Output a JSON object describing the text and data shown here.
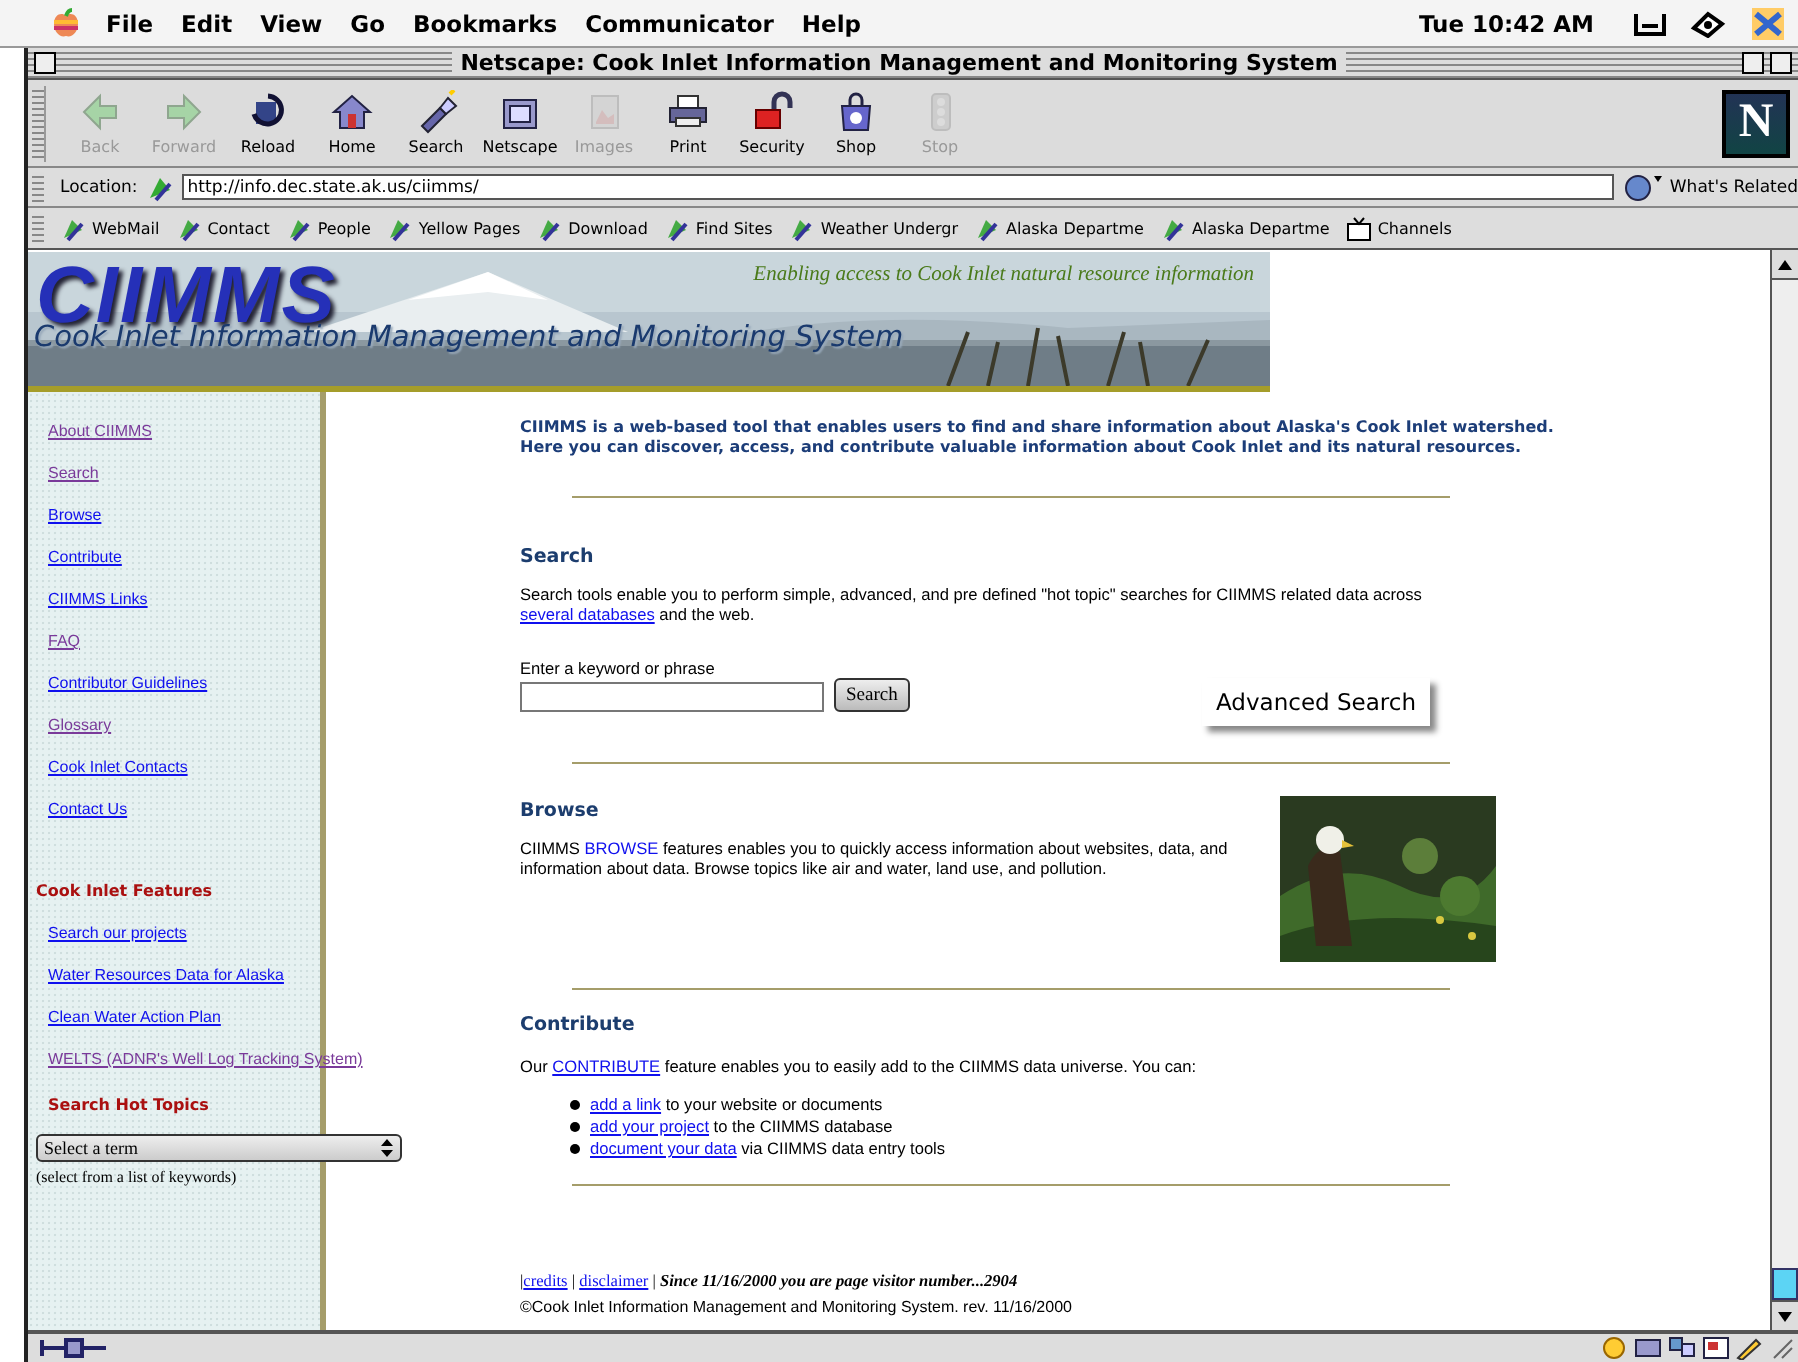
{
  "menu_bar": {
    "menus": [
      "File",
      "Edit",
      "View",
      "Go",
      "Bookmarks",
      "Communicator",
      "Help"
    ],
    "clock": "Tue 10:42 AM"
  },
  "window": {
    "title": "Netscape: Cook Inlet Information Management and Monitoring System"
  },
  "toolbar": {
    "buttons": [
      {
        "label": "Back",
        "disabled": true
      },
      {
        "label": "Forward",
        "disabled": true
      },
      {
        "label": "Reload",
        "disabled": false
      },
      {
        "label": "Home",
        "disabled": false
      },
      {
        "label": "Search",
        "disabled": false
      },
      {
        "label": "Netscape",
        "disabled": false
      },
      {
        "label": "Images",
        "disabled": true
      },
      {
        "label": "Print",
        "disabled": false
      },
      {
        "label": "Security",
        "disabled": false
      },
      {
        "label": "Shop",
        "disabled": false
      },
      {
        "label": "Stop",
        "disabled": true
      }
    ],
    "logo_letter": "N"
  },
  "location_bar": {
    "label": "Location:",
    "url": "http://info.dec.state.ak.us/ciimms/",
    "related": "What's Related"
  },
  "personal_toolbar": {
    "bookmarks": [
      {
        "label": "WebMail",
        "kind": "bookmark"
      },
      {
        "label": "Contact",
        "kind": "bookmark"
      },
      {
        "label": "People",
        "kind": "bookmark"
      },
      {
        "label": "Yellow Pages",
        "kind": "bookmark"
      },
      {
        "label": "Download",
        "kind": "bookmark"
      },
      {
        "label": "Find Sites",
        "kind": "bookmark"
      },
      {
        "label": "Weather Undergr",
        "kind": "bookmark"
      },
      {
        "label": "Alaska Departme",
        "kind": "bookmark"
      },
      {
        "label": "Alaska Departme",
        "kind": "bookmark"
      },
      {
        "label": "Channels",
        "kind": "channel"
      }
    ]
  },
  "banner": {
    "logo": "CIIMMS",
    "subtitle": "Cook Inlet Information Management and Monitoring System",
    "tagline": "Enabling access to Cook Inlet natural resource information"
  },
  "sidebar": {
    "links": [
      {
        "label": "About CIIMMS",
        "visited": true
      },
      {
        "label": "Search",
        "visited": true
      },
      {
        "label": "Browse",
        "visited": false
      },
      {
        "label": "Contribute",
        "visited": false
      },
      {
        "label": "CIIMMS Links",
        "visited": false
      },
      {
        "label": "FAQ",
        "visited": true
      },
      {
        "label": "Contributor Guidelines",
        "visited": false
      },
      {
        "label": "Glossary",
        "visited": true
      },
      {
        "label": "Cook Inlet Contacts",
        "visited": false
      },
      {
        "label": "Contact Us",
        "visited": false
      }
    ],
    "features_heading": "Cook Inlet Features",
    "feature_links": [
      {
        "label": "Search our projects",
        "visited": false
      },
      {
        "label": "Water Resources Data for Alaska",
        "visited": false
      },
      {
        "label": "Clean Water Action Plan",
        "visited": false
      },
      {
        "label": "WELTS (ADNR's Well Log Tracking System)",
        "visited": true
      }
    ],
    "hot_topics_heading": "Search Hot Topics",
    "select_value": "Select a term",
    "select_hint": "(select from a list of keywords)"
  },
  "intro": "CIIMMS is a web-based tool that enables users to find and share information about Alaska's Cook Inlet watershed.\nHere you can discover, access, and contribute valuable information about Cook Inlet and its natural resources.",
  "search_section": {
    "heading": "Search",
    "text": [
      {
        "text": "Search tools enable you to perform simple, advanced, and pre defined \"hot topic\" searches for CIIMMS related data across\n"
      },
      {
        "text": "several databases",
        "link": true,
        "underlined": true
      },
      {
        "text": " and the web."
      }
    ],
    "field_label": "Enter a keyword or phrase",
    "button": "Search",
    "advanced_button": "Advanced Search"
  },
  "browse_section": {
    "heading": "Browse",
    "text": [
      {
        "text": "CIIMMS "
      },
      {
        "text": "BROWSE",
        "link": true,
        "underlined": false
      },
      {
        "text": " features enables you to quickly access information about websites, data, and\ninformation about data. Browse topics like air and water, land use, and pollution."
      }
    ]
  },
  "contribute_section": {
    "heading": "Contribute",
    "text": [
      {
        "text": "Our "
      },
      {
        "text": "CONTRIBUTE",
        "link": true,
        "underlined": true
      },
      {
        "text": " feature enables you to easily add to the CIIMMS data universe. You can:"
      }
    ],
    "bullets": [
      [
        {
          "text": "add a link",
          "link": true,
          "underlined": true
        },
        {
          "text": " to your website or documents"
        }
      ],
      [
        {
          "text": "add your project",
          "link": true,
          "underlined": true
        },
        {
          "text": " to the CIIMMS database"
        }
      ],
      [
        {
          "text": "document your data",
          "link": true,
          "underlined": true
        },
        {
          "text": " via CIIMMS data entry tools"
        }
      ]
    ]
  },
  "footer": {
    "links_line": [
      {
        "text": "|"
      },
      {
        "text": "credits",
        "link": true,
        "underlined": true
      },
      {
        "text": " | "
      },
      {
        "text": "disclaimer",
        "link": true,
        "underlined": true
      },
      {
        "text": " |  "
      },
      {
        "text": "Since 11/16/2000 you are page visitor number...2904",
        "emphasis": true
      }
    ],
    "copyright": "©Cook Inlet Information Management and Monitoring System. rev. 11/16/2000"
  }
}
